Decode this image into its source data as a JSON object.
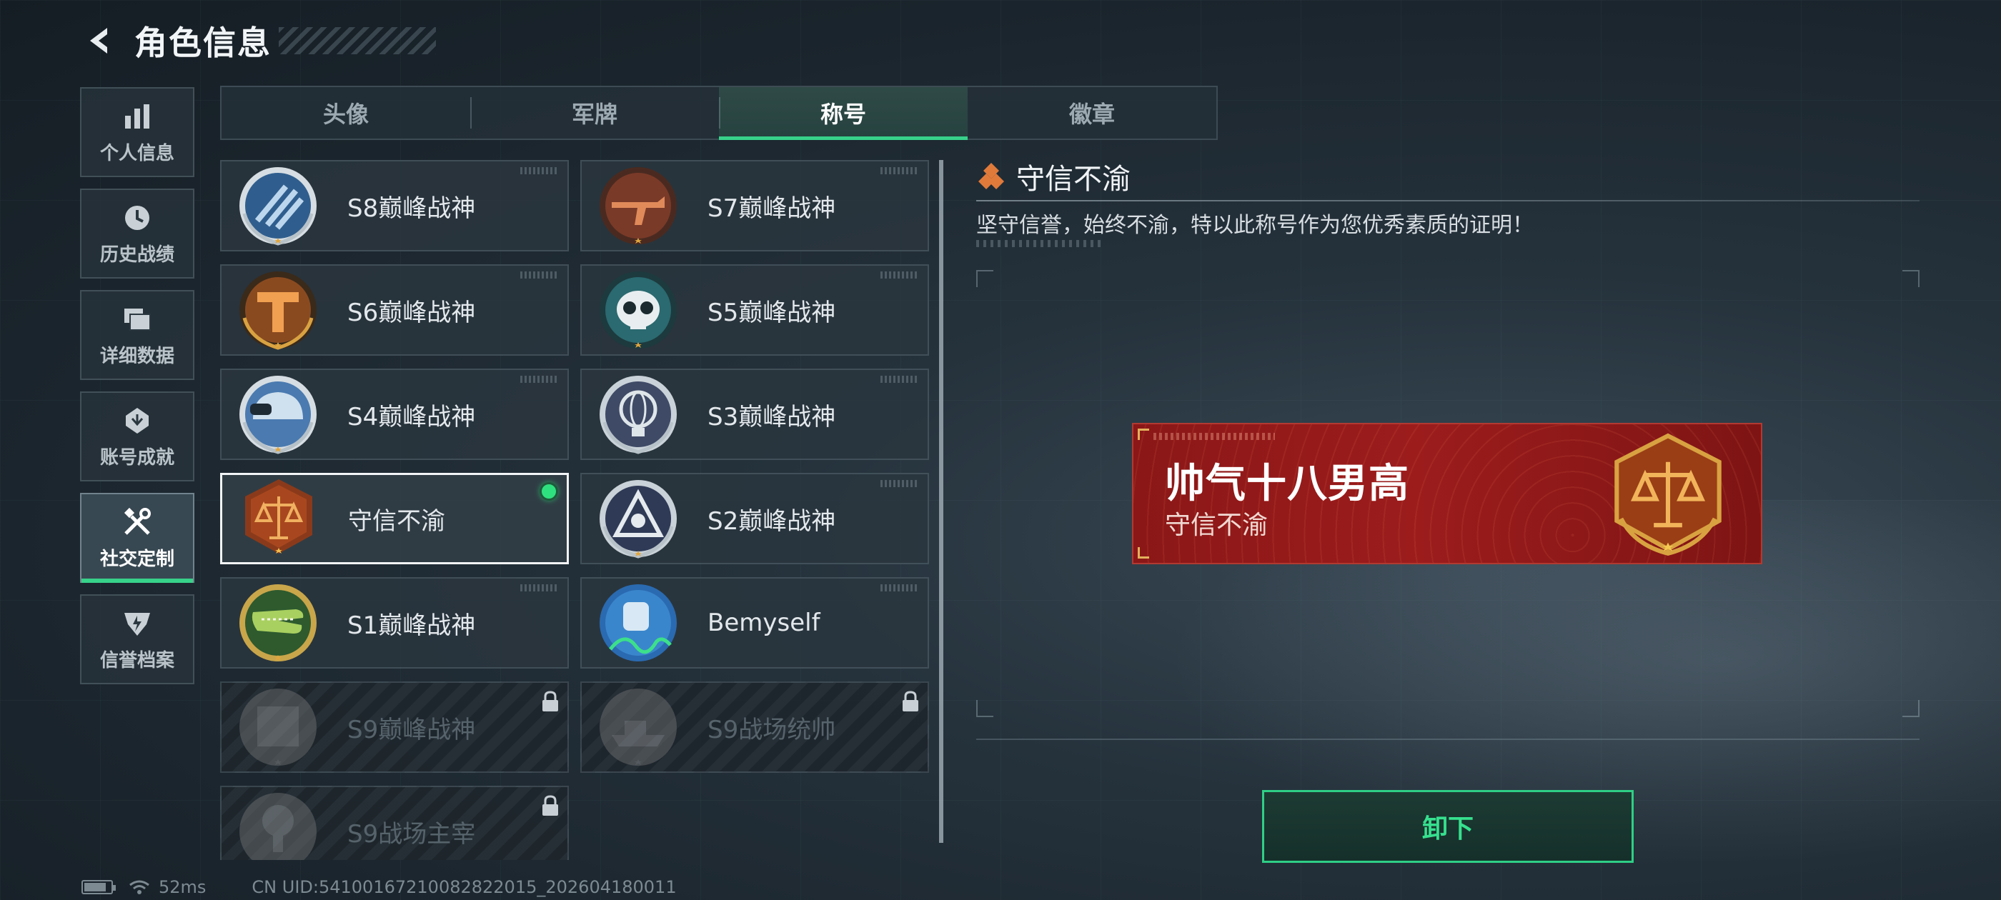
{
  "header": {
    "title": "角色信息"
  },
  "sidebar": {
    "items": [
      {
        "label": "个人信息",
        "icon": "bar-chart-icon"
      },
      {
        "label": "历史战绩",
        "icon": "history-clock-icon"
      },
      {
        "label": "详细数据",
        "icon": "folder-icon"
      },
      {
        "label": "账号成就",
        "icon": "achievement-icon"
      },
      {
        "label": "社交定制",
        "icon": "tools-icon",
        "active": true
      },
      {
        "label": "信誉档案",
        "icon": "credit-badge-icon"
      }
    ]
  },
  "tabs": [
    {
      "label": "头像"
    },
    {
      "label": "军牌"
    },
    {
      "label": "称号",
      "active": true
    },
    {
      "label": "徽章"
    }
  ],
  "titles": [
    {
      "label": "S8巅峰战神",
      "emblem": "blue-stripes-emblem",
      "locked": false
    },
    {
      "label": "S7巅峰战神",
      "emblem": "copper-gun-emblem",
      "locked": false
    },
    {
      "label": "S6巅峰战神",
      "emblem": "bronze-t-emblem",
      "locked": false
    },
    {
      "label": "S5巅峰战神",
      "emblem": "teal-skull-emblem",
      "locked": false
    },
    {
      "label": "S4巅峰战神",
      "emblem": "helmet-emblem",
      "locked": false
    },
    {
      "label": "S3巅峰战神",
      "emblem": "globe-emblem",
      "locked": false
    },
    {
      "label": "守信不渝",
      "emblem": "scales-emblem",
      "locked": false,
      "selected": true,
      "equipped": true
    },
    {
      "label": "S2巅峰战神",
      "emblem": "triangle-eye-emblem",
      "locked": false
    },
    {
      "label": "S1巅峰战神",
      "emblem": "crocodile-emblem",
      "locked": false
    },
    {
      "label": "Bemyself",
      "emblem": "signature-emblem",
      "locked": false
    },
    {
      "label": "S9巅峰战神",
      "emblem": "building-emblem",
      "locked": true
    },
    {
      "label": "S9战场统帅",
      "emblem": "ship-emblem",
      "locked": true
    },
    {
      "label": "S9战场主宰",
      "emblem": "explosion-emblem",
      "locked": true
    }
  ],
  "detail": {
    "title": "守信不渝",
    "description": "坚守信誉，始终不渝，特以此称号作为您优秀素质的证明！"
  },
  "preview": {
    "player_name": "帅气十八男高",
    "title": "守信不渝"
  },
  "actions": {
    "unequip_label": "卸下"
  },
  "status": {
    "ping": "52ms",
    "uid": "CN UID:54100167210082822015_202604180011"
  },
  "colors": {
    "accent": "#37d28a",
    "preview_red": "#9c1c1c",
    "gold": "#d9a241"
  }
}
